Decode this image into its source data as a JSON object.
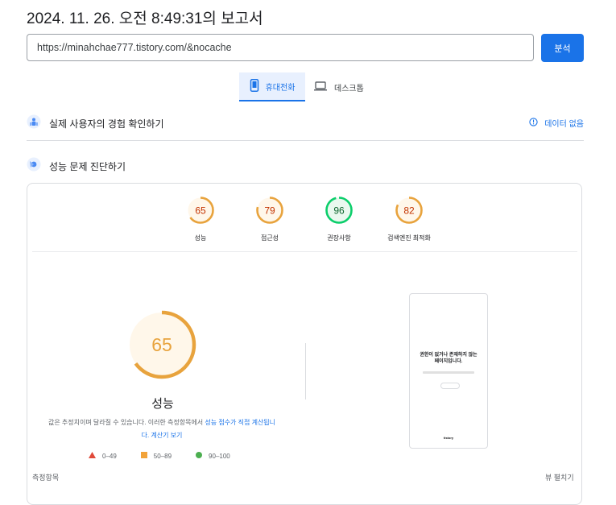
{
  "report": {
    "title": "2024. 11. 26. 오전 8:49:31의 보고서"
  },
  "search": {
    "url": "https://minahchae777.tistory.com/&nocache",
    "button_label": "분석"
  },
  "device_tabs": [
    {
      "label": "휴대전화",
      "icon": "smartphone-icon",
      "selected": true
    },
    {
      "label": "데스크톱",
      "icon": "laptop-icon",
      "selected": false
    }
  ],
  "field_data": {
    "label": "실제 사용자의 경험 확인하기",
    "status": "데이터 없음",
    "icon": "users-icon",
    "status_icon": "info-icon"
  },
  "diagnose": {
    "label": "성능 문제 진단하기",
    "icon": "lighthouse-icon"
  },
  "scores": [
    {
      "value": "65",
      "label": "성능",
      "fraction": 0.65,
      "color": "#e8a33d",
      "text_color": "#c33300"
    },
    {
      "value": "79",
      "label": "접근성",
      "fraction": 0.79,
      "color": "#e8a33d",
      "text_color": "#c33300"
    },
    {
      "value": "96",
      "label": "권장사항",
      "fraction": 0.96,
      "color": "#0cce6b",
      "text_color": "#0d652d"
    },
    {
      "value": "82",
      "label": "검색엔진 최적화",
      "fraction": 0.82,
      "color": "#e8a33d",
      "text_color": "#c33300"
    }
  ],
  "performance": {
    "value": "65",
    "fraction": 0.65,
    "label": "성능",
    "desc_prefix": "값은 추정치이며 달라질 수 있습니다. 이러한 측정항목에서 ",
    "desc_link1": "성능 점수가 직접 계산됩니",
    "desc_link2": "다. 계산기 보기",
    "ring_color": "#e8a33d",
    "fill_color": "#fff7ea",
    "text_color": "#e8a33d"
  },
  "legend": [
    {
      "shape": "triangle",
      "range": "0–49",
      "color": "#e04a3a"
    },
    {
      "shape": "square",
      "range": "50–89",
      "color": "#f2a33a"
    },
    {
      "shape": "circle",
      "range": "90–100",
      "color": "#4caf50"
    }
  ],
  "screenshot": {
    "heading_line1": "권한이 없거나 존재하지 않는",
    "heading_line2": "페이지입니다.",
    "footer": "tistory"
  },
  "footer": {
    "metrics_label": "측정항목",
    "expand_label": "뷰 펼치기"
  }
}
